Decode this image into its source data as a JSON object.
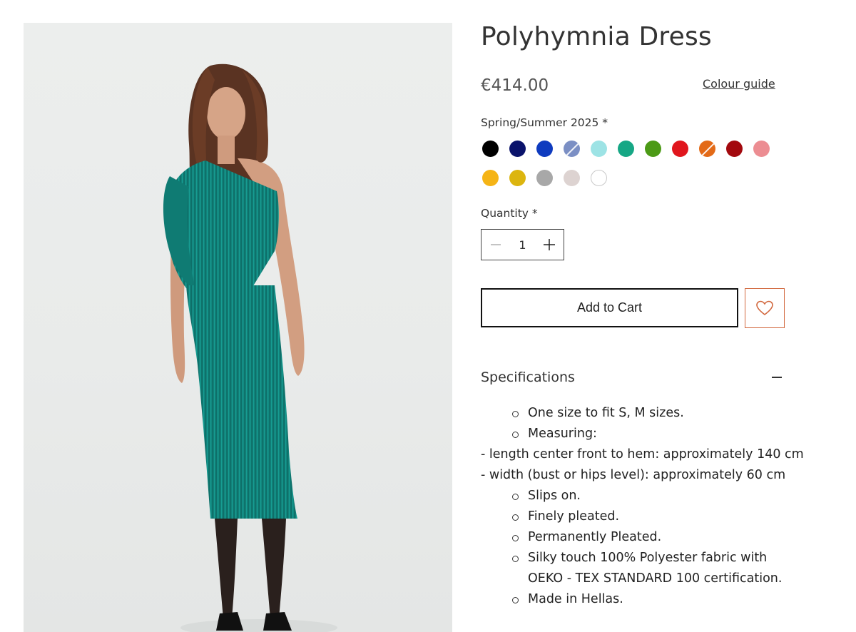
{
  "product": {
    "title": "Polyhymnia Dress",
    "price": "€414.00",
    "colour_guide_label": "Colour guide",
    "image_alt": "Model wearing a teal pleated one-shoulder dress"
  },
  "colours": {
    "label": "Spring/Summer 2025 *",
    "swatches": [
      {
        "name": "black",
        "hex": "#000000"
      },
      {
        "name": "navy",
        "hex": "#0a136b"
      },
      {
        "name": "royal-blue",
        "hex": "#0f3bbf"
      },
      {
        "name": "periwinkle",
        "hex": "#7b8fc4",
        "unavailable": true
      },
      {
        "name": "light-cyan",
        "hex": "#9de3e5"
      },
      {
        "name": "jade",
        "hex": "#16a785"
      },
      {
        "name": "green",
        "hex": "#4c9a16"
      },
      {
        "name": "red",
        "hex": "#e0161d"
      },
      {
        "name": "orange",
        "hex": "#e36a17",
        "unavailable": true
      },
      {
        "name": "dark-red",
        "hex": "#a3090e"
      },
      {
        "name": "pink",
        "hex": "#ec8d92"
      },
      {
        "name": "amber",
        "hex": "#f5b416"
      },
      {
        "name": "mustard",
        "hex": "#dcb50f"
      },
      {
        "name": "grey",
        "hex": "#a8a8a8"
      },
      {
        "name": "light-taupe",
        "hex": "#ddd3d1"
      },
      {
        "name": "white",
        "hex": "#ffffff"
      }
    ]
  },
  "quantity": {
    "label": "Quantity *",
    "value": "1"
  },
  "actions": {
    "add_to_cart": "Add to Cart"
  },
  "specifications": {
    "title": "Specifications",
    "lines": [
      {
        "type": "bullet",
        "text": "One size to fit S, M sizes."
      },
      {
        "type": "bullet",
        "text": "Measuring:"
      },
      {
        "type": "plain",
        "text": "- length center front to hem: approximately 140 cm"
      },
      {
        "type": "plain",
        "text": "- width (bust or hips level): approximately 60 cm"
      },
      {
        "type": "bullet",
        "text": "Slips on."
      },
      {
        "type": "bullet",
        "text": "Finely pleated."
      },
      {
        "type": "bullet",
        "text": "Permanently Pleated."
      },
      {
        "type": "bullet",
        "text": "Silky touch 100% Polyester fabric with"
      },
      {
        "type": "cont",
        "text": "OEKO - TEX STANDARD 100 certification."
      },
      {
        "type": "bullet",
        "text": "Made in Hellas."
      }
    ]
  },
  "theme": {
    "accent": "#d2683e",
    "dress": "#138f86"
  }
}
